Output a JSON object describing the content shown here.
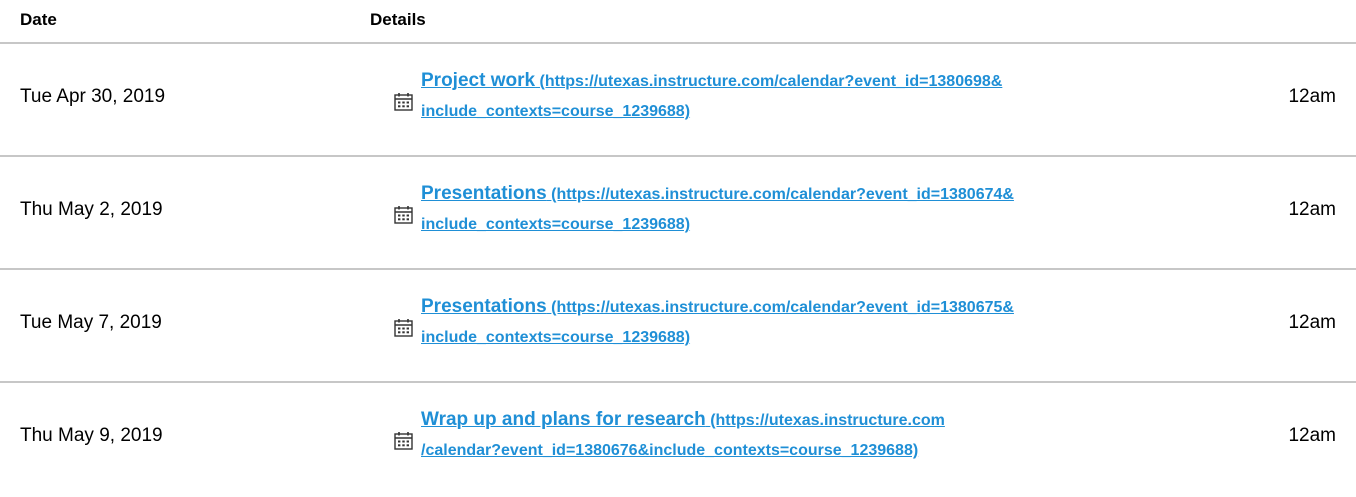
{
  "header": {
    "date_label": "Date",
    "details_label": "Details"
  },
  "rows": [
    {
      "date": "Tue Apr 30, 2019",
      "title": "Project work",
      "url_line1": "(https://utexas.instructure.com/calendar?event_id=1380698&",
      "url_line2": "include_contexts=course_1239688)",
      "time": "12am",
      "icon": "calendar-icon"
    },
    {
      "date": "Thu May 2, 2019",
      "title": "Presentations",
      "url_line1": "(https://utexas.instructure.com/calendar?event_id=1380674&",
      "url_line2": "include_contexts=course_1239688)",
      "time": "12am",
      "icon": "calendar-icon"
    },
    {
      "date": "Tue May 7, 2019",
      "title": "Presentations",
      "url_line1": "(https://utexas.instructure.com/calendar?event_id=1380675&",
      "url_line2": "include_contexts=course_1239688)",
      "time": "12am",
      "icon": "calendar-icon"
    },
    {
      "date": "Thu May 9, 2019",
      "title": "Wrap up and plans for research",
      "url_line1": "(https://utexas.instructure.com",
      "url_line2": "/calendar?event_id=1380676&include_contexts=course_1239688)",
      "time": "12am",
      "icon": "calendar-icon"
    }
  ],
  "colors": {
    "link": "#1f8fd6",
    "divider": "#c7c7c7"
  }
}
